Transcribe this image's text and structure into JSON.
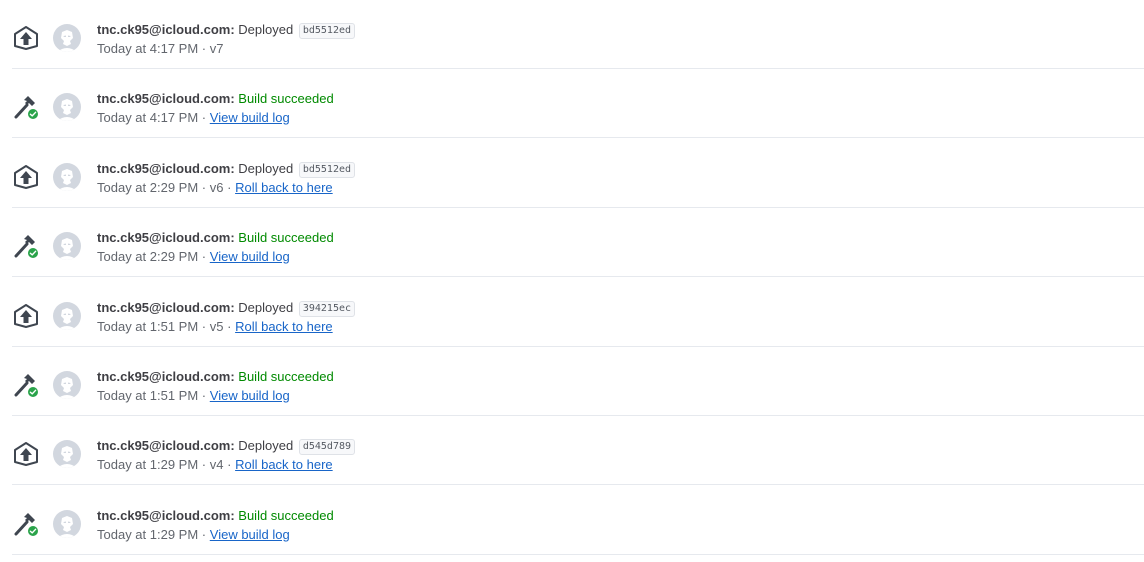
{
  "activity": [
    {
      "kind": "deploy",
      "type_icon": "deploy-upload-icon",
      "avatar_icon": "default-user-avatar-icon",
      "user": "tnc.ck95@icloud.com:",
      "action": "Deployed",
      "commit": "bd5512ed",
      "time": "Today at 4:17 PM",
      "separator": "·",
      "version": "v7",
      "link": ""
    },
    {
      "kind": "build",
      "type_icon": "build-hammer-icon",
      "status_icon": "check-circle-icon",
      "avatar_icon": "default-user-avatar-icon",
      "user": "tnc.ck95@icloud.com:",
      "action": "Build succeeded",
      "commit": "",
      "time": "Today at 4:17 PM",
      "separator": "·",
      "version": "",
      "link": "View build log"
    },
    {
      "kind": "deploy",
      "type_icon": "deploy-upload-icon",
      "avatar_icon": "default-user-avatar-icon",
      "user": "tnc.ck95@icloud.com:",
      "action": "Deployed",
      "commit": "bd5512ed",
      "time": "Today at 2:29 PM",
      "separator": "·",
      "version": "v6",
      "link": "Roll back to here"
    },
    {
      "kind": "build",
      "type_icon": "build-hammer-icon",
      "status_icon": "check-circle-icon",
      "avatar_icon": "default-user-avatar-icon",
      "user": "tnc.ck95@icloud.com:",
      "action": "Build succeeded",
      "commit": "",
      "time": "Today at 2:29 PM",
      "separator": "·",
      "version": "",
      "link": "View build log"
    },
    {
      "kind": "deploy",
      "type_icon": "deploy-upload-icon",
      "avatar_icon": "default-user-avatar-icon",
      "user": "tnc.ck95@icloud.com:",
      "action": "Deployed",
      "commit": "394215ec",
      "time": "Today at 1:51 PM",
      "separator": "·",
      "version": "v5",
      "link": "Roll back to here"
    },
    {
      "kind": "build",
      "type_icon": "build-hammer-icon",
      "status_icon": "check-circle-icon",
      "avatar_icon": "default-user-avatar-icon",
      "user": "tnc.ck95@icloud.com:",
      "action": "Build succeeded",
      "commit": "",
      "time": "Today at 1:51 PM",
      "separator": "·",
      "version": "",
      "link": "View build log"
    },
    {
      "kind": "deploy",
      "type_icon": "deploy-upload-icon",
      "avatar_icon": "default-user-avatar-icon",
      "user": "tnc.ck95@icloud.com:",
      "action": "Deployed",
      "commit": "d545d789",
      "time": "Today at 1:29 PM",
      "separator": "·",
      "version": "v4",
      "link": "Roll back to here"
    },
    {
      "kind": "build",
      "type_icon": "build-hammer-icon",
      "status_icon": "check-circle-icon",
      "avatar_icon": "default-user-avatar-icon",
      "user": "tnc.ck95@icloud.com:",
      "action": "Build succeeded",
      "commit": "",
      "time": "Today at 1:29 PM",
      "separator": "·",
      "version": "",
      "link": "View build log"
    }
  ],
  "colors": {
    "success": "#008a00",
    "link": "#1865c8",
    "icon": "#3f4650",
    "check": "#2aa34a",
    "avatar_bg": "#d2d7df"
  }
}
